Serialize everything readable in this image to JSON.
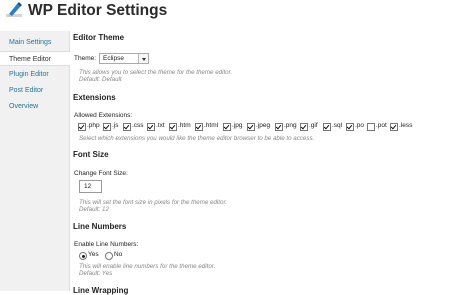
{
  "header": {
    "title": "WP Editor Settings",
    "logo_icon": "pencil-icon"
  },
  "sidebar": {
    "items": [
      {
        "label": "Main Settings",
        "active": false
      },
      {
        "label": "Theme Editor",
        "active": true
      },
      {
        "label": "Plugin Editor",
        "active": false
      },
      {
        "label": "Post Editor",
        "active": false
      },
      {
        "label": "Overview",
        "active": false
      }
    ]
  },
  "editor_theme": {
    "heading": "Editor Theme",
    "theme_label": "Theme:",
    "theme_value": "Eclipse",
    "desc1": "This allows you to select the theme for the theme editor.",
    "desc2": "Default: Default"
  },
  "extensions": {
    "heading": "Extensions",
    "allowed_label": "Allowed Extensions:",
    "items": [
      {
        "label": ".php",
        "checked": true
      },
      {
        "label": ".js",
        "checked": true
      },
      {
        "label": ".css",
        "checked": true
      },
      {
        "label": ".txt",
        "checked": true
      },
      {
        "label": ".htm",
        "checked": true
      },
      {
        "label": ".html",
        "checked": true
      },
      {
        "label": ".jpg",
        "checked": true
      },
      {
        "label": ".jpeg",
        "checked": true
      },
      {
        "label": ".png",
        "checked": true
      },
      {
        "label": ".gif",
        "checked": true
      },
      {
        "label": ".sql",
        "checked": true
      },
      {
        "label": ".po",
        "checked": true
      },
      {
        "label": ".pot",
        "checked": false
      },
      {
        "label": ".less",
        "checked": true
      }
    ],
    "desc": "Select which extensions you would like the theme editor browser to be able to access."
  },
  "font_size": {
    "heading": "Font Size",
    "label": "Change Font Size:",
    "value": "12",
    "desc1": "This will set the font size in pixels for the theme editor.",
    "desc2": "Default: 12"
  },
  "line_numbers": {
    "heading": "Line Numbers",
    "label": "Enable Line Numbers:",
    "yes": "Yes",
    "no": "No",
    "selected": "Yes",
    "desc1": "This will enable line numbers for the theme editor.",
    "desc2": "Default: Yes"
  },
  "line_wrapping": {
    "heading": "Line Wrapping"
  }
}
